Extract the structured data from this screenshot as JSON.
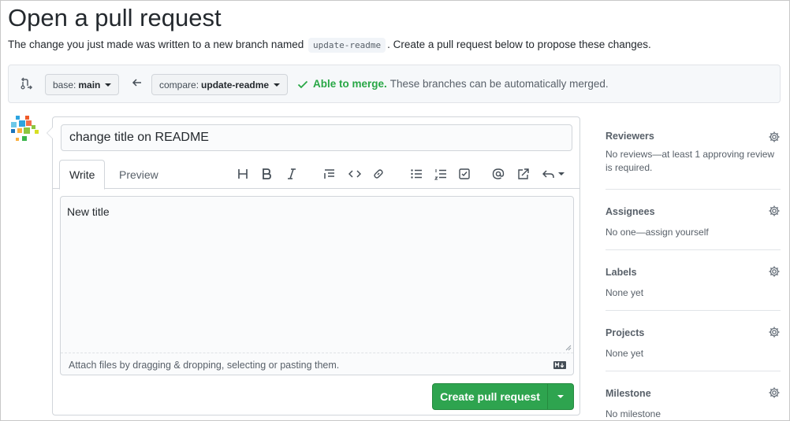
{
  "page": {
    "title": "Open a pull request",
    "subtitle_before": "The change you just made was written to a new branch named",
    "branch_code": "update-readme",
    "subtitle_after": ". Create a pull request below to propose these changes."
  },
  "compare": {
    "base_label": "base:",
    "base_value": "main",
    "compare_label": "compare:",
    "compare_value": "update-readme",
    "merge_strong": "Able to merge.",
    "merge_text": "These branches can be automatically merged."
  },
  "form": {
    "title_value": "change title on README",
    "tabs": [
      "Write",
      "Preview"
    ],
    "body_text": "New title",
    "footer_text": "Attach files by dragging & dropping, selecting or pasting them.",
    "submit_label": "Create pull request",
    "toolbar_icons": [
      "heading-icon",
      "bold-icon",
      "italic-icon",
      "quote-icon",
      "code-icon",
      "link-icon",
      "bulleted-list-icon",
      "numbered-list-icon",
      "task-list-icon",
      "mention-icon",
      "reference-icon",
      "reply-icon"
    ]
  },
  "sidebar": {
    "sections": [
      {
        "title": "Reviewers",
        "body": "No reviews—at least 1 approving review is required."
      },
      {
        "title": "Assignees",
        "body": "No one—assign yourself"
      },
      {
        "title": "Labels",
        "body": "None yet"
      },
      {
        "title": "Projects",
        "body": "None yet"
      },
      {
        "title": "Milestone",
        "body": "No milestone"
      }
    ]
  },
  "colors": {
    "accent_green": "#2ea44f",
    "merge_green": "#28a745"
  }
}
